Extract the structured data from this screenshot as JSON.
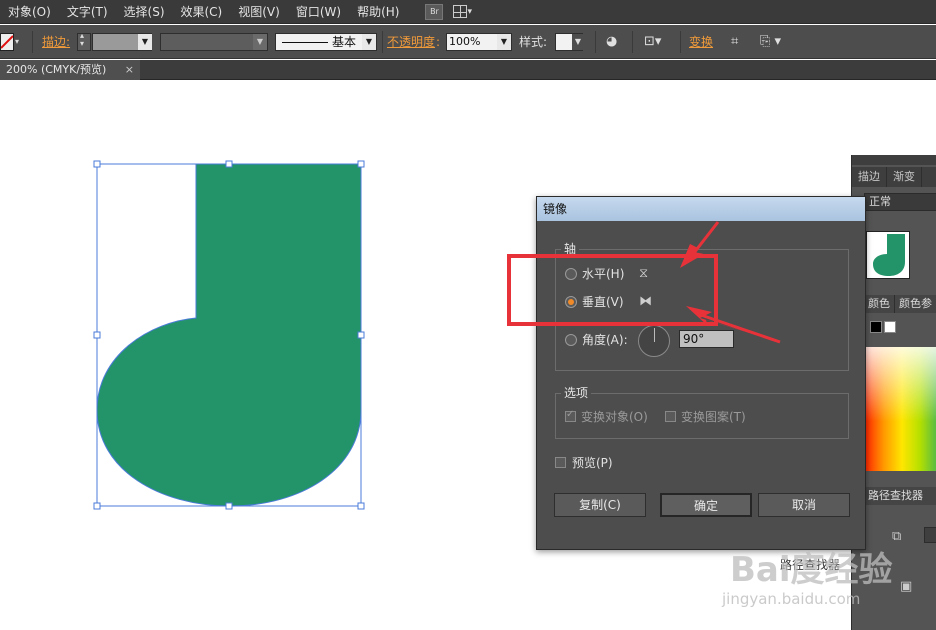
{
  "menu": {
    "items": [
      "对象(O)",
      "文字(T)",
      "选择(S)",
      "效果(C)",
      "视图(V)",
      "窗口(W)",
      "帮助(H)"
    ],
    "bridge_label": "Br"
  },
  "control_bar": {
    "stroke_label": "描边:",
    "stroke_profile": "基本",
    "opacity_label": "不透明度",
    "opacity_value": "100%",
    "style_label": "样式:",
    "transform_label": "变换"
  },
  "document_tab": {
    "title": "200% (CMYK/预览)",
    "close": "×"
  },
  "side_panel": {
    "tabs": [
      "描边",
      "渐变"
    ],
    "blend_mode": "正常",
    "color_tabs": [
      "颜色",
      "颜色参"
    ],
    "pathfinder_title": "路径查找器"
  },
  "dialog": {
    "title": "镜像",
    "axis_group": "轴",
    "horizontal_label": "水平(H)",
    "vertical_label": "垂直(V)",
    "angle_label": "角度(A):",
    "angle_value": "90°",
    "options_group": "选项",
    "transform_objects_label": "变换对象(O)",
    "transform_patterns_label": "变换图案(T)",
    "preview_label": "预览(P)",
    "copy_button": "复制(C)",
    "ok_button": "确定",
    "cancel_button": "取消",
    "selected_axis": "vertical",
    "transform_objects_checked": true,
    "transform_patterns_checked": false,
    "preview_checked": false
  },
  "canvas_under_dialog_text": "路径查找器",
  "watermark": {
    "brand": "Bai度经验",
    "url": "jingyan.baidu.com"
  },
  "colors": {
    "shape_fill": "#23946a",
    "selection": "#4a7bd8",
    "annotation": "#e8323a",
    "accent": "#f09a3a"
  }
}
